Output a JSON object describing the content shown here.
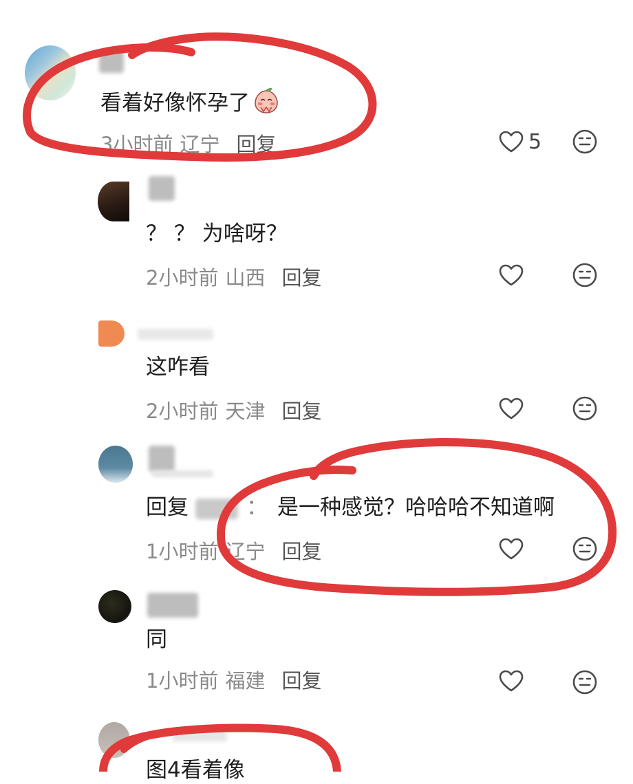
{
  "comments": [
    {
      "text": "看着好像怀孕了",
      "emoji": "blushing-peach-emoji",
      "time": "3小时前",
      "location": "辽宁",
      "reply_label": "回复",
      "like_count": "5"
    },
    {
      "text": "？ ？ 为啥呀？",
      "time": "2小时前",
      "location": "山西",
      "reply_label": "回复"
    },
    {
      "text": "这咋看",
      "time": "2小时前",
      "location": "天津",
      "reply_label": "回复"
    },
    {
      "reply_prefix": "回复",
      "colon": "：",
      "text": "是一种感觉？哈哈哈不知道啊",
      "time": "1小时前",
      "location": "辽宁",
      "reply_label": "回复"
    },
    {
      "text": "同",
      "time": "1小时前",
      "location": "福建",
      "reply_label": "回复"
    },
    {
      "text": "图4看着像"
    }
  ],
  "icons": {
    "like": "heart-outline-icon",
    "dislike": "meh-face-icon"
  },
  "colors": {
    "annotation": "#e03a3a",
    "meta_text": "#8a8a8a",
    "body_text": "#1e1e1e"
  }
}
